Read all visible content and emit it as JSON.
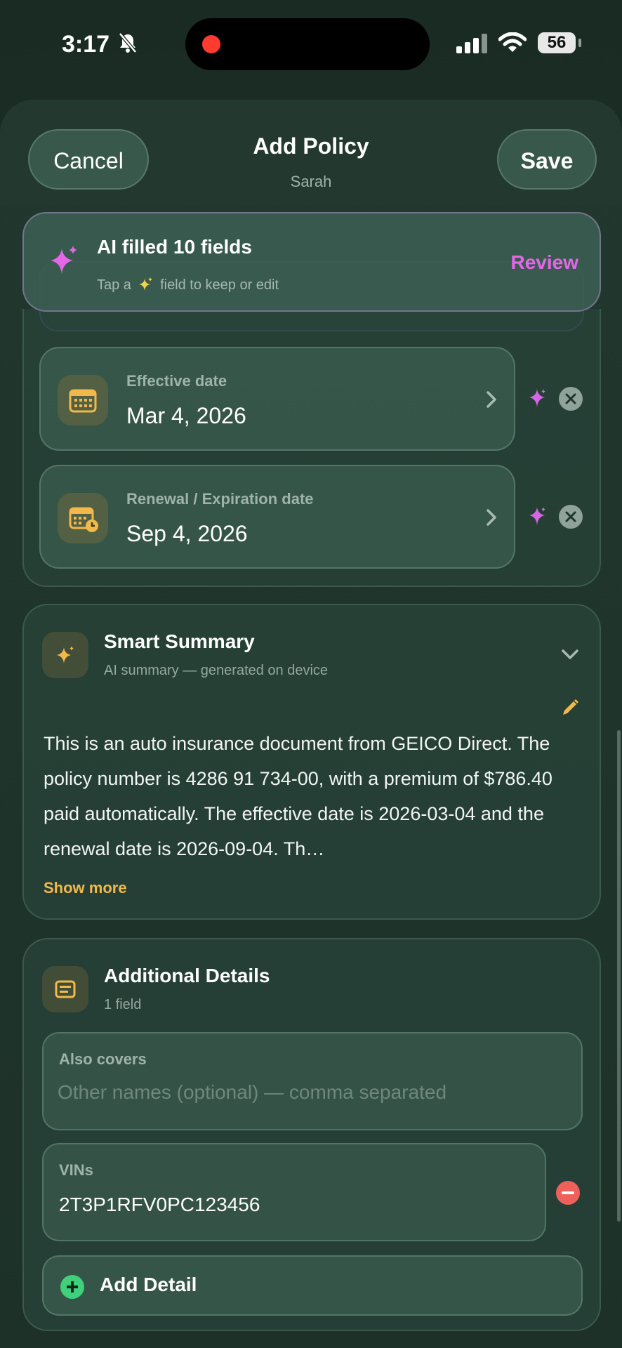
{
  "status_bar": {
    "time": "3:17",
    "battery": "56"
  },
  "nav": {
    "cancel_label": "Cancel",
    "title": "Add Policy",
    "subtitle": "Sarah",
    "save_label": "Save"
  },
  "ai_banner": {
    "title": "AI filled 10 fields",
    "subtitle_prefix": "Tap a",
    "subtitle_suffix": "field to keep or edit",
    "review_label": "Review"
  },
  "dates": [
    {
      "label": "Effective date",
      "value": "Mar 4, 2026",
      "icon": "calendar-icon"
    },
    {
      "label": "Renewal / Expiration date",
      "value": "Sep 4, 2026",
      "icon": "calendar-clock-icon"
    }
  ],
  "summary": {
    "title": "Smart Summary",
    "subtitle": "AI summary — generated on device",
    "text": "This is an auto insurance document from GEICO Direct. The policy number is 4286 91 734-00, with a premium of $786.40 paid automatically. The effective date is 2026-03-04 and the renewal date is 2026-09-04. Th…",
    "show_more": "Show more"
  },
  "details": {
    "title": "Additional Details",
    "subtitle": "1 field",
    "also_covers_label": "Also covers",
    "also_covers_placeholder": "Other names (optional) — comma separated",
    "vins_label": "VINs",
    "vins_value": "2T3P1RFV0PC123456",
    "add_label": "Add Detail"
  },
  "colors": {
    "accent_pink": "#e367e6",
    "accent_gold": "#f2b94a",
    "remove_red": "#f0605a",
    "add_green": "#3ed07a"
  }
}
